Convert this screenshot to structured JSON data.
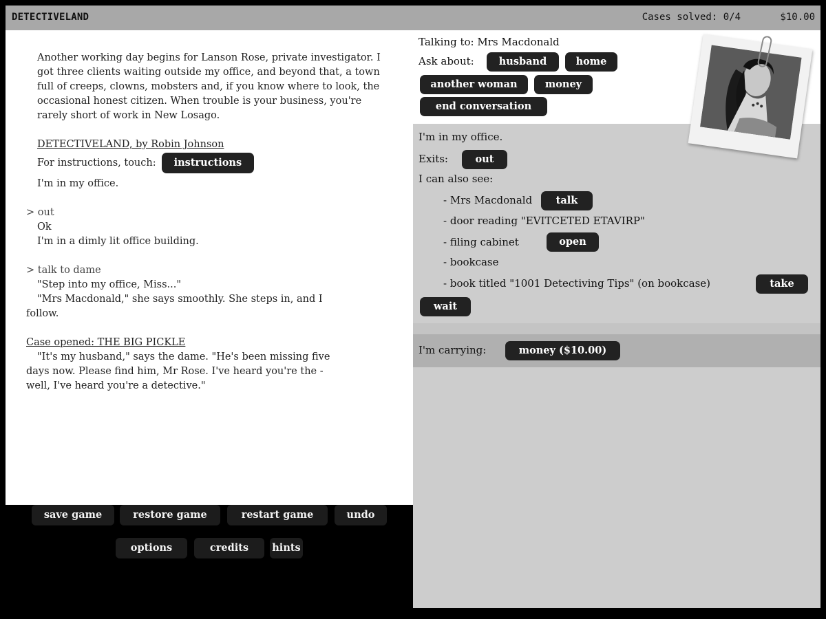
{
  "header": {
    "title": "DETECTIVELAND",
    "cases_solved": "Cases solved: 0/4",
    "money": "$10.00"
  },
  "transcript": {
    "intro": "Another working day begins for Lanson Rose, private investigator. I got three clients waiting outside my office, and beyond that, a town full of creeps, clowns, mobsters and, if you know where to look, the occasional honest citizen. When trouble is your business, you're rarely short of work in New Losago.",
    "credit_line": "DETECTIVELAND, by Robin Johnson",
    "instructions_prompt": "For instructions, touch:",
    "instructions_button": "instructions",
    "office_line": "I'm in my office.",
    "cmd_out": "> out",
    "ok": "Ok",
    "dimly_lit": "I'm in a dimly lit office building.",
    "cmd_talk": "> talk to dame",
    "step_into": "\"Step into my office, Miss...\"",
    "mrs_mac_line1": "\"Mrs Macdonald,\" she says smoothly. She steps in, and I",
    "mrs_mac_line2": "follow.",
    "case_opened_label": "Case opened: THE BIG PICKLE",
    "husband_line1": "\"It's my husband,\" says the dame. \"He's been missing five",
    "husband_line2": "days now. Please find him, Mr Rose. I've heard you're the -",
    "husband_line3": "well, I've heard you're a detective.\""
  },
  "conversation": {
    "talking_to": "Talking to: Mrs Macdonald",
    "ask_about_label": "Ask about:",
    "topics": [
      "husband",
      "home",
      "another woman",
      "money"
    ],
    "end_button": "end conversation",
    "photo_icon": "portrait-photo-icon"
  },
  "room": {
    "location": "I'm in my office.",
    "exits_label": "Exits:",
    "exit_out": "out",
    "see_label": "I can also see:",
    "items": [
      {
        "text": "- Mrs Macdonald",
        "action": "talk"
      },
      {
        "text": "- door reading \"EVITCETED ETAVIRP\"",
        "action": ""
      },
      {
        "text": "- filing cabinet",
        "action": "open"
      },
      {
        "text": "- bookcase",
        "action": ""
      },
      {
        "text": "- book titled \"1001 Detectiving Tips\" (on bookcase)",
        "action": "take"
      }
    ],
    "wait_button": "wait"
  },
  "inventory": {
    "label": "I'm carrying:",
    "items": [
      "money ($10.00)"
    ]
  },
  "system_buttons": {
    "save": "save game",
    "restore": "restore game",
    "restart": "restart game",
    "undo": "undo",
    "options": "options",
    "credits": "credits",
    "hints": "hints"
  },
  "colors": {
    "header_bg": "#a8a8a8",
    "pill_bg": "#222222",
    "room_bg": "#cdcdcd",
    "carry_bg": "#b0b0b0"
  }
}
